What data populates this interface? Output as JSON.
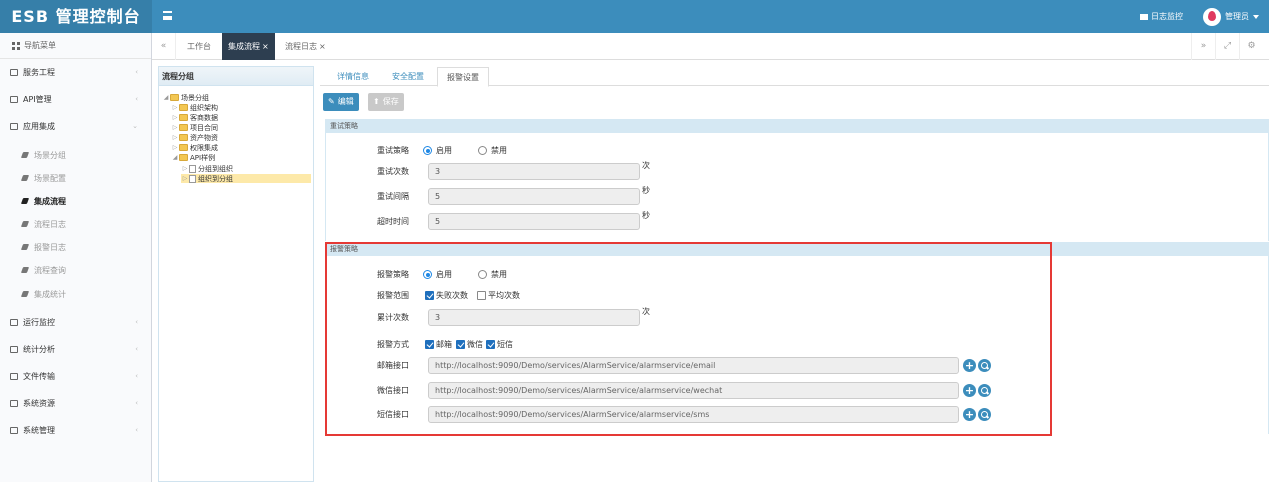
{
  "app": {
    "title": "ESB 管理控制台"
  },
  "topbar": {
    "log_monitor": "日志监控",
    "user": "管理员"
  },
  "sidebar": {
    "header": "导航菜单",
    "items": [
      {
        "label": "服务工程"
      },
      {
        "label": "API管理"
      },
      {
        "label": "应用集成"
      },
      {
        "label": "运行监控"
      },
      {
        "label": "统计分析"
      },
      {
        "label": "文件传输"
      },
      {
        "label": "系统资源"
      },
      {
        "label": "系统管理"
      }
    ],
    "subitems": [
      {
        "label": "场景分组"
      },
      {
        "label": "场景配置"
      },
      {
        "label": "集成流程"
      },
      {
        "label": "流程日志"
      },
      {
        "label": "报警日志"
      },
      {
        "label": "流程查询"
      },
      {
        "label": "集成统计"
      }
    ]
  },
  "tabbar": {
    "tabs": [
      {
        "label": "工作台"
      },
      {
        "label": "集成流程",
        "close": "×"
      },
      {
        "label": "流程日志",
        "close": "×"
      }
    ]
  },
  "tree": {
    "title": "流程分组",
    "nodes": [
      {
        "label": "场景分组"
      },
      {
        "label": "组织架构"
      },
      {
        "label": "客商数据"
      },
      {
        "label": "项目合同"
      },
      {
        "label": "资产物资"
      },
      {
        "label": "权限集成"
      },
      {
        "label": "API样例"
      },
      {
        "label": "分组到组织"
      },
      {
        "label": "组织到分组"
      }
    ]
  },
  "detail": {
    "tabs": [
      {
        "label": "详情信息"
      },
      {
        "label": "安全配置"
      },
      {
        "label": "报警设置"
      }
    ],
    "edit_button": "编辑",
    "save_button": "保存",
    "retry": {
      "header": "重试策略",
      "policy_label": "重试策略",
      "enable": "启用",
      "disable": "禁用",
      "count_label": "重试次数",
      "count_value": "3",
      "count_unit": "次",
      "interval_label": "重试间隔",
      "interval_value": "5",
      "interval_unit": "秒",
      "timeout_label": "超时时间",
      "timeout_value": "5",
      "timeout_unit": "秒"
    },
    "alarm": {
      "header": "报警策略",
      "policy_label": "报警策略",
      "enable": "启用",
      "disable": "禁用",
      "scope_label": "报警范围",
      "scope_fail": "失败次数",
      "scope_avg": "平均次数",
      "cum_label": "累计次数",
      "cum_value": "3",
      "cum_unit": "次",
      "method_label": "报警方式",
      "method_mail": "邮箱",
      "method_wechat": "微信",
      "method_sms": "短信",
      "mail_label": "邮箱接口",
      "mail_url": "http://localhost:9090/Demo/services/AlarmService/alarmservice/email",
      "wechat_label": "微信接口",
      "wechat_url": "http://localhost:9090/Demo/services/AlarmService/alarmservice/wechat",
      "sms_label": "短信接口",
      "sms_url": "http://localhost:9090/Demo/services/AlarmService/alarmservice/sms"
    }
  },
  "colors": {
    "topbar": "#3c8dbc",
    "brand": "#367fa9",
    "active_tab": "#2d3e50",
    "highlight_box": "#e53935"
  }
}
